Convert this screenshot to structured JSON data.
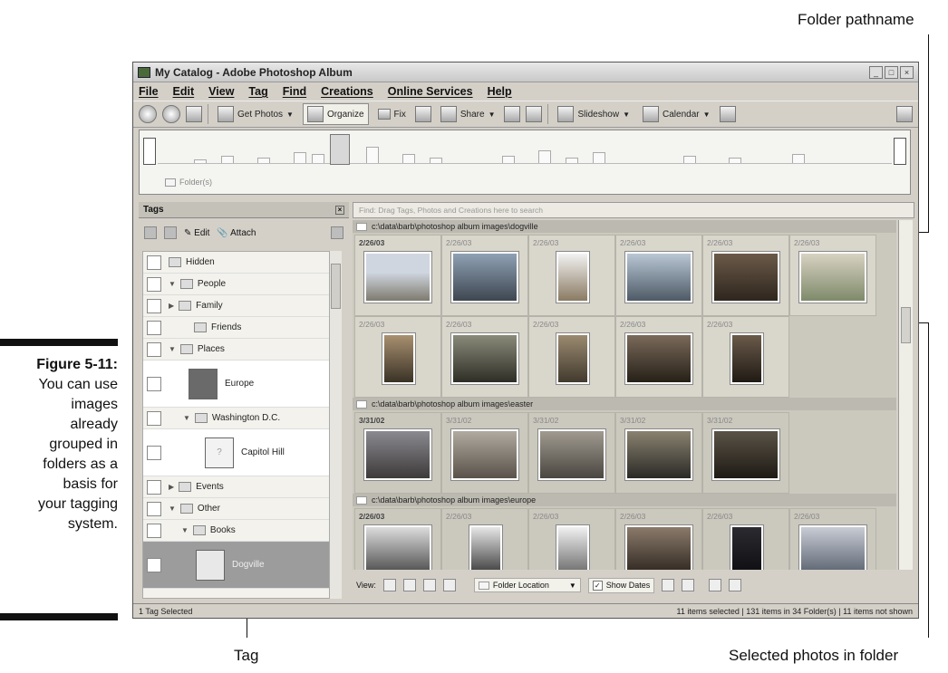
{
  "figure": {
    "number": "Figure 5-11:",
    "caption_lines": [
      "You can use",
      "images",
      "already",
      "grouped in",
      "folders as a",
      "basis for",
      "your tagging",
      "system."
    ]
  },
  "callouts": {
    "folder_pathname": "Folder pathname",
    "tag": "Tag",
    "selected_photos": "Selected photos in folder"
  },
  "window": {
    "title": "My Catalog - Adobe Photoshop Album",
    "menu": [
      "File",
      "Edit",
      "View",
      "Tag",
      "Find",
      "Creations",
      "Online Services",
      "Help"
    ],
    "toolbar": {
      "get_photos": "Get Photos",
      "organize": "Organize",
      "fix": "Fix",
      "share": "Share",
      "slideshow": "Slideshow",
      "calendar": "Calendar"
    },
    "timeline_label": "Folder(s)"
  },
  "tags_pane": {
    "header": "Tags",
    "edit": "Edit",
    "attach": "Attach",
    "items": [
      {
        "label": "Hidden"
      },
      {
        "label": "People"
      },
      {
        "label": "Family"
      },
      {
        "label": "Friends"
      },
      {
        "label": "Places"
      },
      {
        "label": "Europe"
      },
      {
        "label": "Washington D.C."
      },
      {
        "label": "Capitol Hill"
      },
      {
        "label": "Events"
      },
      {
        "label": "Other"
      },
      {
        "label": "Books"
      },
      {
        "label": "Dogville"
      }
    ]
  },
  "photo_pane": {
    "find_hint": "Find: Drag Tags, Photos and Creations here to search",
    "folders": [
      {
        "path": "c:\\data\\barb\\photoshop album images\\dogville",
        "dates": [
          "2/26/03",
          "2/26/03",
          "2/26/03",
          "2/26/03",
          "2/26/03",
          "2/26/03",
          "2/26/03",
          "2/26/03",
          "2/26/03",
          "2/26/03",
          "2/26/03"
        ]
      },
      {
        "path": "c:\\data\\barb\\photoshop album images\\easter",
        "dates": [
          "3/31/02",
          "3/31/02",
          "3/31/02",
          "3/31/02",
          "3/31/02"
        ]
      },
      {
        "path": "c:\\data\\barb\\photoshop album images\\europe",
        "dates": [
          "2/26/03",
          "2/26/03",
          "2/26/03",
          "2/26/03",
          "2/26/03",
          "2/26/03"
        ]
      }
    ]
  },
  "viewbar": {
    "view_label": "View:",
    "folder_location": "Folder Location",
    "show_dates": "Show Dates"
  },
  "status": {
    "left": "1 Tag Selected",
    "right": "11 items selected | 131 items in 34 Folder(s) | 11 items not shown"
  }
}
